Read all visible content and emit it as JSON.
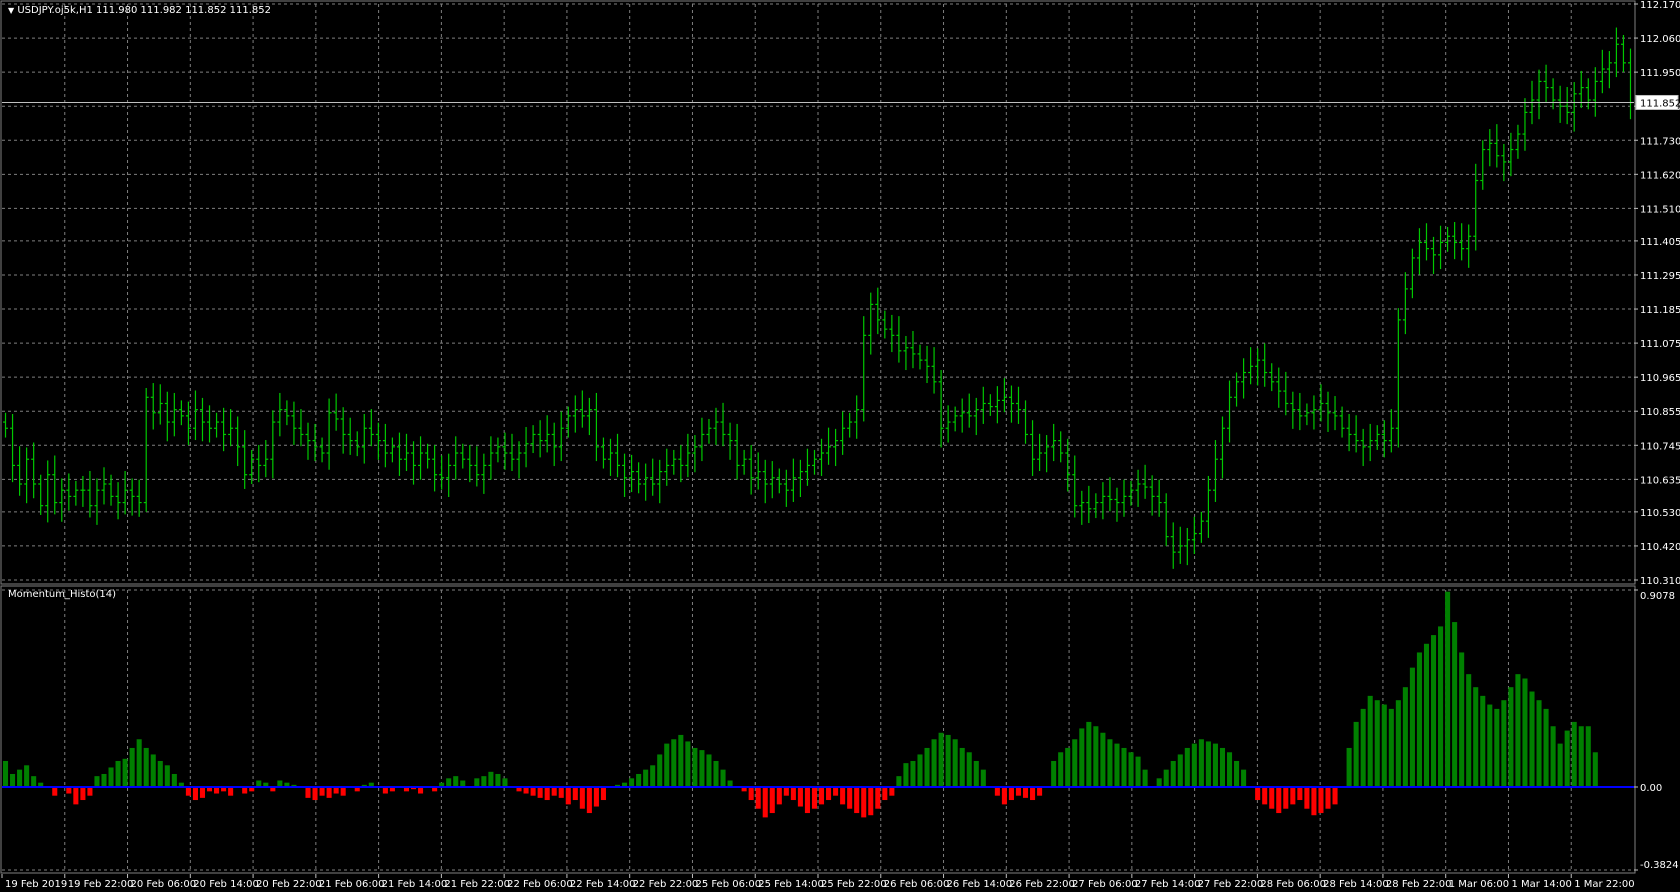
{
  "main_pane": {
    "symbol_line": "USDJPY.oj5k,H1  111.980 111.982 111.852 111.852",
    "price_levels": [
      "112.170",
      "112.060",
      "111.950",
      "111.840",
      "111.730",
      "111.620",
      "111.510",
      "111.405",
      "111.295",
      "111.185",
      "111.075",
      "110.965",
      "110.855",
      "110.745",
      "110.635",
      "110.530",
      "110.420",
      "110.310"
    ],
    "current_price": "111.852",
    "colors": {
      "background": "#000000",
      "bars": "#00c800",
      "grid": "#7f7f7f",
      "price_line": "#c0c0c0"
    }
  },
  "indicator_pane": {
    "name": "Momentum_Histo(14)",
    "levels": [
      "0.9078",
      "0.00",
      "-0.3824"
    ],
    "colors": {
      "positive": "#008000",
      "negative": "#ff0000",
      "zero_line": "#0000ff"
    }
  },
  "time_axis": {
    "labels": [
      "19 Feb 2019",
      "19 Feb 22:00",
      "20 Feb 06:00",
      "20 Feb 14:00",
      "20 Feb 22:00",
      "21 Feb 06:00",
      "21 Feb 14:00",
      "21 Feb 22:00",
      "22 Feb 06:00",
      "22 Feb 14:00",
      "22 Feb 22:00",
      "25 Feb 06:00",
      "25 Feb 14:00",
      "25 Feb 22:00",
      "26 Feb 06:00",
      "26 Feb 14:00",
      "26 Feb 22:00",
      "27 Feb 06:00",
      "27 Feb 14:00",
      "27 Feb 22:00",
      "28 Feb 06:00",
      "28 Feb 14:00",
      "28 Feb 22:00",
      "1 Mar 06:00",
      "1 Mar 14:00",
      "1 Mar 22:00"
    ]
  },
  "chart_data": {
    "type": "bar",
    "price_closes": [
      110.8,
      110.68,
      110.62,
      110.7,
      110.62,
      110.55,
      110.65,
      110.56,
      110.6,
      110.58,
      110.6,
      110.6,
      110.55,
      110.6,
      110.62,
      110.58,
      110.56,
      110.6,
      110.58,
      110.56,
      110.9,
      110.85,
      110.88,
      110.82,
      110.86,
      110.84,
      110.8,
      110.86,
      110.82,
      110.8,
      110.82,
      110.78,
      110.8,
      110.74,
      110.65,
      110.7,
      110.68,
      110.7,
      110.82,
      110.86,
      110.84,
      110.8,
      110.78,
      110.76,
      110.74,
      110.72,
      110.85,
      110.83,
      110.78,
      110.76,
      110.74,
      110.8,
      110.78,
      110.76,
      110.72,
      110.74,
      110.7,
      110.72,
      110.68,
      110.72,
      110.7,
      110.65,
      110.64,
      110.68,
      110.72,
      110.7,
      110.68,
      110.65,
      110.68,
      110.72,
      110.74,
      110.72,
      110.7,
      110.72,
      110.75,
      110.78,
      110.76,
      110.78,
      110.74,
      110.8,
      110.84,
      110.86,
      110.84,
      110.86,
      110.74,
      110.7,
      110.72,
      110.68,
      110.64,
      110.66,
      110.62,
      110.64,
      110.62,
      110.66,
      110.68,
      110.7,
      110.68,
      110.72,
      110.74,
      110.78,
      110.8,
      110.82,
      110.78,
      110.76,
      110.68,
      110.7,
      110.64,
      110.66,
      110.62,
      110.64,
      110.62,
      110.6,
      110.64,
      110.66,
      110.68,
      110.7,
      110.72,
      110.74,
      110.76,
      110.8,
      110.82,
      110.86,
      111.1,
      111.2,
      111.15,
      111.12,
      111.1,
      111.05,
      111.06,
      111.04,
      111.02,
      111.0,
      110.95,
      110.8,
      110.82,
      110.84,
      110.85,
      110.84,
      110.86,
      110.88,
      110.87,
      110.89,
      110.9,
      110.88,
      110.86,
      110.78,
      110.7,
      110.72,
      110.74,
      110.76,
      110.72,
      110.65,
      110.55,
      110.56,
      110.54,
      110.56,
      110.58,
      110.57,
      110.56,
      110.58,
      110.6,
      110.62,
      110.61,
      110.58,
      110.56,
      110.45,
      110.4,
      110.42,
      110.44,
      110.46,
      110.5,
      110.6,
      110.7,
      110.8,
      110.9,
      110.95,
      110.98,
      111.0,
      111.02,
      110.98,
      110.95,
      110.92,
      110.88,
      110.86,
      110.84,
      110.85,
      110.86,
      110.88,
      110.85,
      110.84,
      110.8,
      110.78,
      110.76,
      110.74,
      110.76,
      110.78,
      110.76,
      110.8,
      111.15,
      111.25,
      111.35,
      111.4,
      111.38,
      111.36,
      111.4,
      111.42,
      111.4,
      111.38,
      111.42,
      111.6,
      111.7,
      111.72,
      111.68,
      111.66,
      111.7,
      111.75,
      111.82,
      111.86,
      111.92,
      111.9,
      111.86,
      111.84,
      111.82,
      111.88,
      111.9,
      111.86,
      111.92,
      111.96,
      111.98,
      112.04,
      111.98,
      111.852
    ],
    "momentum": [
      0.12,
      0.06,
      0.08,
      0.1,
      0.05,
      0.02,
      0.0,
      -0.04,
      0.0,
      -0.03,
      -0.08,
      -0.06,
      -0.04,
      0.05,
      0.06,
      0.09,
      0.12,
      0.13,
      0.18,
      0.22,
      0.18,
      0.15,
      0.12,
      0.1,
      0.06,
      0.02,
      -0.04,
      -0.06,
      -0.05,
      -0.02,
      -0.03,
      -0.02,
      -0.04,
      0.0,
      -0.03,
      -0.02,
      0.03,
      0.02,
      -0.02,
      0.03,
      0.02,
      0.01,
      0.0,
      -0.05,
      -0.06,
      -0.04,
      -0.05,
      -0.03,
      -0.04,
      0.0,
      -0.02,
      0.01,
      0.02,
      0.0,
      -0.03,
      -0.02,
      0.0,
      -0.02,
      -0.01,
      -0.03,
      0.0,
      -0.02,
      0.02,
      0.04,
      0.05,
      0.03,
      0.0,
      0.04,
      0.05,
      0.07,
      0.06,
      0.04,
      0.0,
      -0.02,
      -0.03,
      -0.04,
      -0.05,
      -0.06,
      -0.04,
      -0.05,
      -0.08,
      -0.06,
      -0.1,
      -0.12,
      -0.09,
      -0.06,
      0.0,
      0.01,
      0.02,
      0.04,
      0.06,
      0.08,
      0.1,
      0.15,
      0.2,
      0.22,
      0.24,
      0.21,
      0.18,
      0.17,
      0.15,
      0.12,
      0.08,
      0.03,
      0.0,
      -0.02,
      -0.06,
      -0.1,
      -0.14,
      -0.12,
      -0.08,
      -0.04,
      -0.06,
      -0.09,
      -0.12,
      -0.1,
      -0.08,
      -0.06,
      -0.04,
      -0.08,
      -0.1,
      -0.12,
      -0.14,
      -0.13,
      -0.1,
      -0.06,
      -0.04,
      0.05,
      0.11,
      0.12,
      0.15,
      0.18,
      0.22,
      0.25,
      0.24,
      0.22,
      0.18,
      0.16,
      0.12,
      0.08,
      0.0,
      -0.04,
      -0.08,
      -0.06,
      -0.04,
      -0.05,
      -0.06,
      -0.04,
      0.0,
      0.12,
      0.16,
      0.18,
      0.22,
      0.27,
      0.3,
      0.28,
      0.25,
      0.22,
      0.2,
      0.18,
      0.16,
      0.14,
      0.08,
      0.0,
      0.04,
      0.08,
      0.12,
      0.15,
      0.18,
      0.2,
      0.22,
      0.21,
      0.2,
      0.18,
      0.16,
      0.12,
      0.08,
      0.0,
      -0.06,
      -0.08,
      -0.1,
      -0.12,
      -0.1,
      -0.08,
      -0.06,
      -0.1,
      -0.13,
      -0.12,
      -0.1,
      -0.08,
      0.0,
      0.18,
      0.3,
      0.36,
      0.42,
      0.4,
      0.38,
      0.36,
      0.4,
      0.46,
      0.55,
      0.62,
      0.66,
      0.7,
      0.74,
      0.9,
      0.76,
      0.62,
      0.52,
      0.46,
      0.42,
      0.38,
      0.36,
      0.4,
      0.46,
      0.52,
      0.5,
      0.44,
      0.4,
      0.36,
      0.28,
      0.2,
      0.26,
      0.3,
      0.28,
      0.28,
      0.16
    ],
    "price_ylim": [
      110.31,
      112.17
    ],
    "momentum_ylim": [
      -0.3824,
      0.9078
    ]
  }
}
